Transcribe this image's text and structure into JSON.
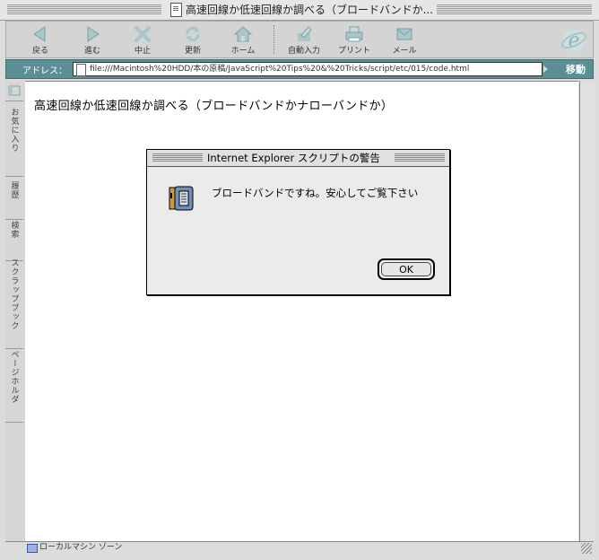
{
  "window": {
    "title": "高速回線か低速回線か調べる（ブロードバンドか..."
  },
  "toolbar": {
    "buttons": [
      {
        "label": "戻る",
        "icon": "back-arrow-icon"
      },
      {
        "label": "進む",
        "icon": "forward-arrow-icon"
      },
      {
        "label": "中止",
        "icon": "stop-x-icon"
      },
      {
        "label": "更新",
        "icon": "refresh-icon"
      },
      {
        "label": "ホーム",
        "icon": "home-icon"
      },
      {
        "label": "自動入力",
        "icon": "autofill-pencil-icon"
      },
      {
        "label": "プリント",
        "icon": "printer-icon"
      },
      {
        "label": "メール",
        "icon": "mail-envelope-icon"
      }
    ]
  },
  "address": {
    "label": "アドレス：",
    "url": "file:///Macintosh%20HDD/本の原稿/JavaScript%20Tips%20&%20Tricks/script/etc/015/code.html",
    "go_label": "移動"
  },
  "sidebar": {
    "tabs": [
      {
        "label": "お気に入り"
      },
      {
        "label": "履歴"
      },
      {
        "label": "検索"
      },
      {
        "label": "スクラップブック"
      },
      {
        "label": "ページホルダ"
      }
    ]
  },
  "content": {
    "heading": "高速回線か低速回線か調べる（ブロードバンドかナローバンドか）"
  },
  "dialog": {
    "title": "Internet Explorer スクリプトの警告",
    "message": "ブロードバンドですね。安心してご覧下さい",
    "ok_label": "OK",
    "icon": "script-alert-icon"
  },
  "status": {
    "text": "ローカルマシン ゾーン",
    "icon": "computer-zone-icon"
  },
  "colors": {
    "address_bar": "#5c8f93",
    "window_bg": "#dcdcdc",
    "content_bg": "#ffffff"
  }
}
